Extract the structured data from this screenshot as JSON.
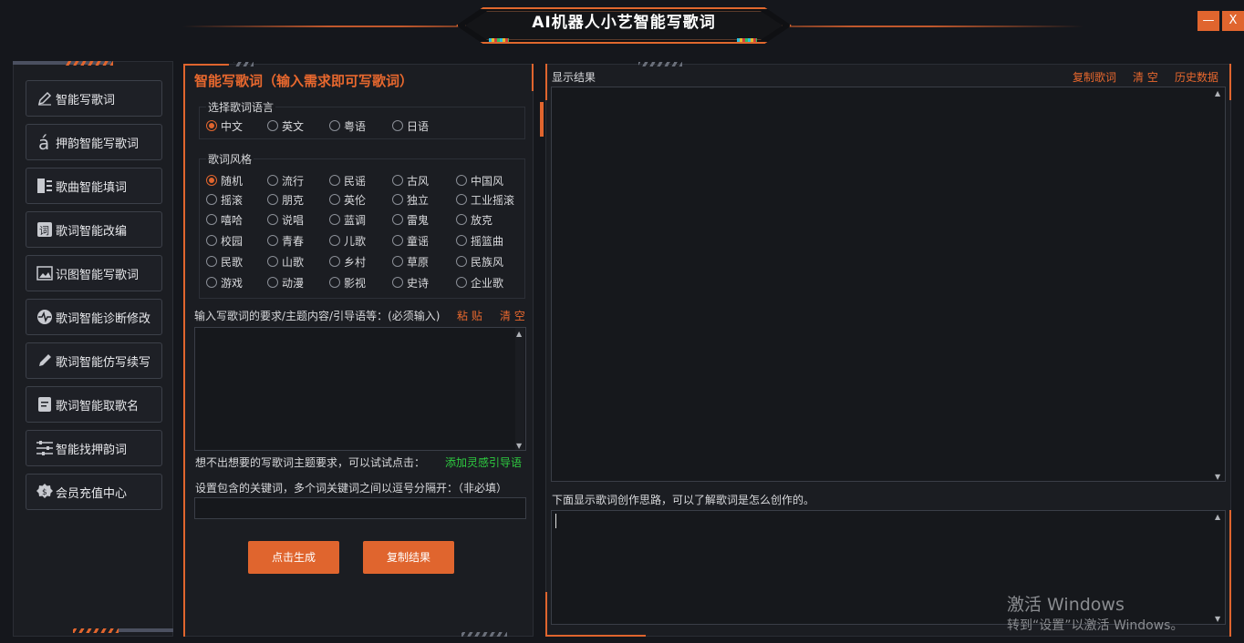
{
  "app": {
    "title": "AI机器人小艺智能写歌词",
    "minimize": "—",
    "close": "X"
  },
  "sidebar": {
    "items": [
      {
        "label": "智能写歌词",
        "icon": "pen-icon"
      },
      {
        "label": "押韵智能写歌词",
        "icon": "accent-a-icon"
      },
      {
        "label": "歌曲智能填词",
        "icon": "list-fill-icon"
      },
      {
        "label": "歌词智能改编",
        "icon": "word-box-icon"
      },
      {
        "label": "识图智能写歌词",
        "icon": "image-icon"
      },
      {
        "label": "歌词智能诊断修改",
        "icon": "pulse-icon"
      },
      {
        "label": "歌词智能仿写续写",
        "icon": "pencil-icon"
      },
      {
        "label": "歌词智能取歌名",
        "icon": "document-icon"
      },
      {
        "label": "智能找押韵词",
        "icon": "sliders-icon"
      },
      {
        "label": "会员充值中心",
        "icon": "badge-icon"
      }
    ]
  },
  "middle": {
    "title": "智能写歌词（输入需求即可写歌词）",
    "language": {
      "label": "选择歌词语言",
      "options": [
        "中文",
        "英文",
        "粤语",
        "日语"
      ],
      "selected": "中文"
    },
    "style": {
      "label": "歌词风格",
      "selected": "随机",
      "rows": [
        [
          "随机",
          "流行",
          "民谣",
          "古风",
          "中国风"
        ],
        [
          "摇滚",
          "朋克",
          "英伦",
          "独立",
          "工业摇滚"
        ],
        [
          "嘻哈",
          "说唱",
          "蓝调",
          "雷鬼",
          "放克"
        ],
        [
          "校园",
          "青春",
          "儿歌",
          "童谣",
          "摇篮曲"
        ],
        [
          "民歌",
          "山歌",
          "乡村",
          "草原",
          "民族风"
        ],
        [
          "游戏",
          "动漫",
          "影视",
          "史诗",
          "企业歌"
        ]
      ]
    },
    "input_label": "输入写歌词的要求/主题内容/引导语等：(必须输入)",
    "paste": "粘 贴",
    "clear": "清 空",
    "input_value": "",
    "hint": "想不出想要的写歌词主题要求，可以试试点击：",
    "hint_link": "添加灵感引导语",
    "keyword_label": "设置包含的关键词，多个词关键词之间以逗号分隔开：（非必填）",
    "keyword_value": "",
    "generate": "点击生成",
    "copy_result": "复制结果"
  },
  "right": {
    "label": "显示结果",
    "copy_lyrics": "复制歌词",
    "clear": "清 空",
    "history": "历史数据",
    "result_value": "",
    "thinking_label": "下面显示歌词创作思路，可以了解歌词是怎么创作的。",
    "thinking_value": ""
  },
  "watermark": {
    "line1": "激活 Windows",
    "line2": "转到“设置”以激活 Windows。"
  },
  "colors": {
    "accent": "#e0652e",
    "background": "#15171c",
    "link_green": "#2ecc40"
  }
}
